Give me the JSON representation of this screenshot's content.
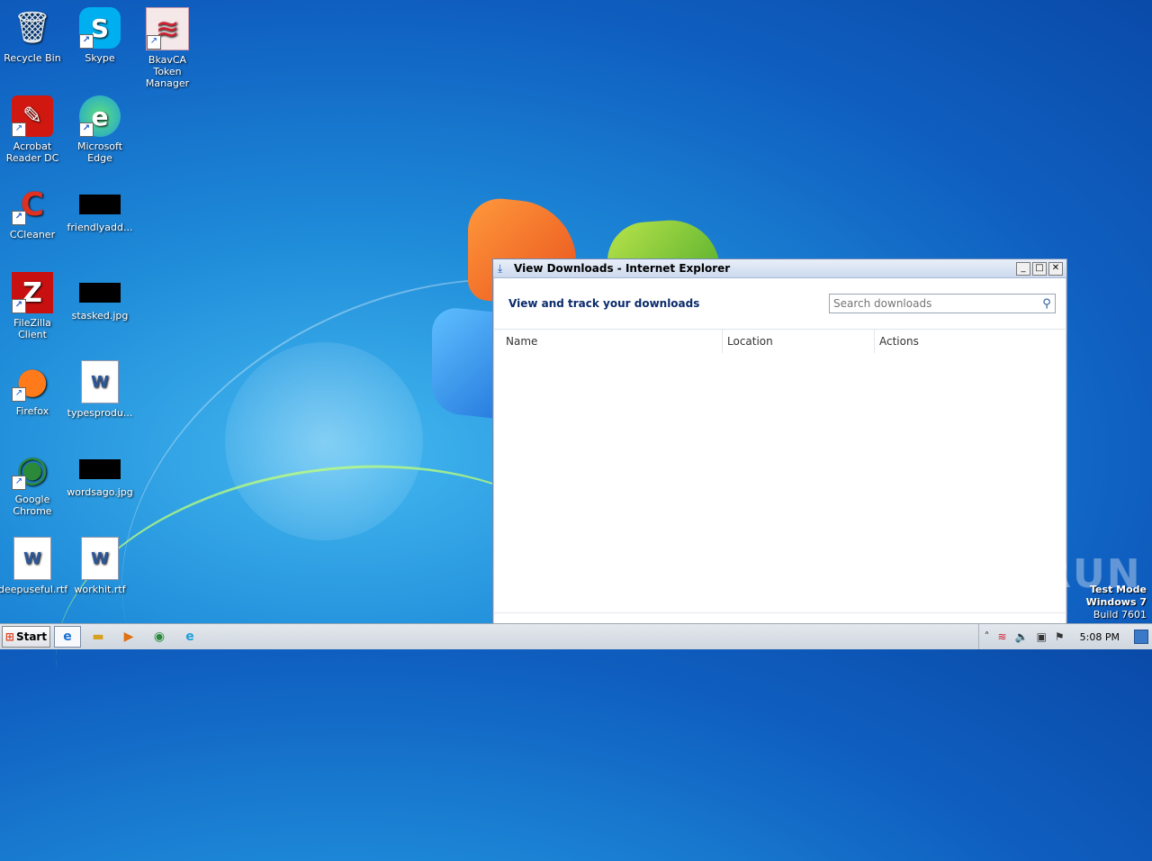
{
  "desktop": {
    "icons": [
      {
        "label": "Recycle Bin",
        "glyph": "🗑",
        "color": "#dfe8f0"
      },
      {
        "label": "Skype",
        "glyph": "S",
        "color": "#00aff0"
      },
      {
        "label": "BkavCA Token Manager",
        "glyph": "≋",
        "color": "#d02030"
      },
      {
        "label": "Acrobat Reader DC",
        "glyph": "✎",
        "color": "#d01810"
      },
      {
        "label": "Microsoft Edge",
        "glyph": "e",
        "color": "#1fa0d8"
      },
      {
        "label": "CCleaner",
        "glyph": "C",
        "color": "#e03020"
      },
      {
        "label": "friendlyadd...",
        "glyph": "",
        "color": "#000000"
      },
      {
        "label": "FileZilla Client",
        "glyph": "Z",
        "color": "#c81010"
      },
      {
        "label": "stasked.jpg",
        "glyph": "",
        "color": "#000000"
      },
      {
        "label": "Firefox",
        "glyph": "●",
        "color": "#ff7a1a"
      },
      {
        "label": "typesprodu...",
        "glyph": "W",
        "color": "#2b579a"
      },
      {
        "label": "Google Chrome",
        "glyph": "◉",
        "color": "#2a8a3a"
      },
      {
        "label": "wordsago.jpg",
        "glyph": "",
        "color": "#000000"
      },
      {
        "label": "deepuseful.rtf",
        "glyph": "W",
        "color": "#2b579a"
      },
      {
        "label": "workhit.rtf",
        "glyph": "W",
        "color": "#2b579a"
      }
    ]
  },
  "window": {
    "title": "View Downloads - Internet Explorer",
    "heading": "View and track your downloads",
    "search_placeholder": "Search downloads",
    "columns": {
      "name": "Name",
      "location": "Location",
      "actions": "Actions"
    }
  },
  "watermark": "ANY.RUN",
  "testmode": {
    "line1": "Test Mode",
    "line2": "Windows 7",
    "line3": "Build 7601"
  },
  "taskbar": {
    "start_label": "Start",
    "clock": "5:08 PM"
  }
}
